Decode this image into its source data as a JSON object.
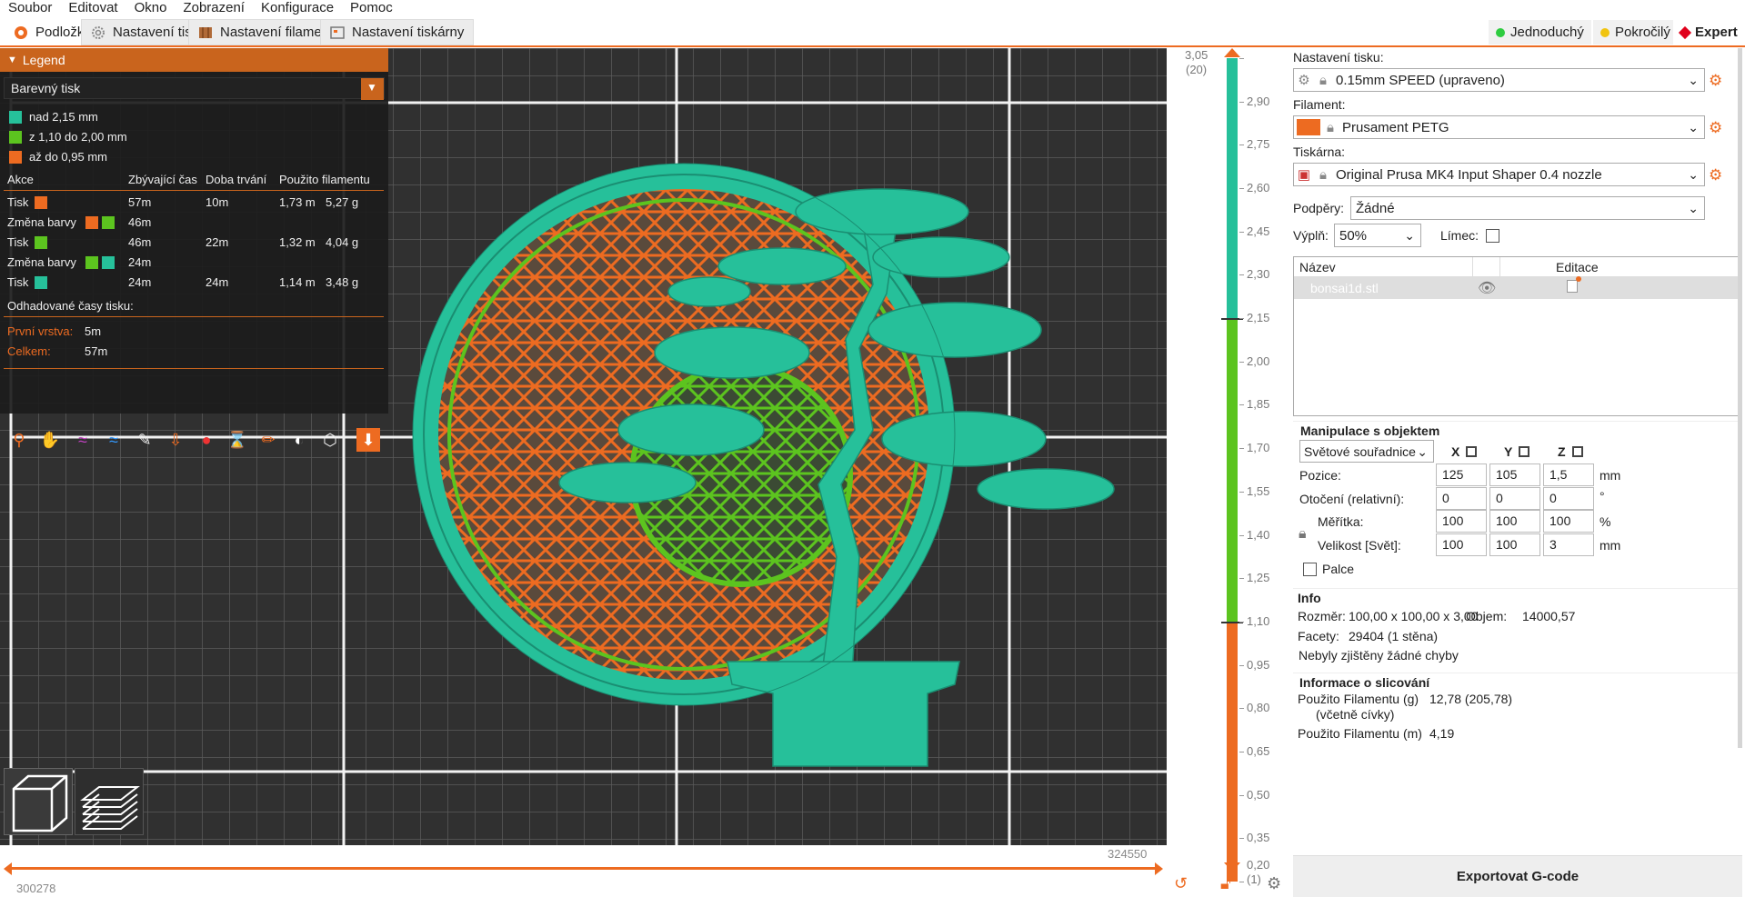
{
  "menu": [
    "Soubor",
    "Editovat",
    "Okno",
    "Zobrazení",
    "Konfigurace",
    "Pomoc"
  ],
  "tabs": [
    {
      "label": "Podložka",
      "icon": "plate-icon"
    },
    {
      "label": "Nastavení tisku",
      "icon": "gear-icon"
    },
    {
      "label": "Nastavení filamentu",
      "icon": "filament-spool-icon"
    },
    {
      "label": "Nastavení tiskárny",
      "icon": "printer-icon"
    }
  ],
  "modes": [
    {
      "label": "Jednoduchý",
      "color": "#2ecc40"
    },
    {
      "label": "Pokročilý",
      "color": "#f1c40f"
    },
    {
      "label": "Expert",
      "color": "#e0001b"
    }
  ],
  "legend": {
    "title": "Legend",
    "view_type": "Barevný tisk",
    "ranges": [
      {
        "label": "nad 2,15 mm",
        "color": "#26c09a"
      },
      {
        "label": "z 1,10 do 2,00 mm",
        "color": "#5cc41f"
      },
      {
        "label": "až do 0,95 mm",
        "color": "#ed6b21"
      }
    ],
    "columns": [
      "Akce",
      "Zbývající čas",
      "Doba trvání",
      "Použito filamentu"
    ],
    "rows": [
      {
        "action": "Tisk",
        "remaining": "57m",
        "duration": "10m",
        "meters": "1,73 m",
        "grams": "5,27 g"
      },
      {
        "action": "Změna barvy",
        "remaining": "46m",
        "duration": "",
        "meters": "",
        "grams": ""
      },
      {
        "action": "Tisk",
        "remaining": "46m",
        "duration": "22m",
        "meters": "1,32 m",
        "grams": "4,04 g"
      },
      {
        "action": "Změna barvy",
        "remaining": "24m",
        "duration": "",
        "meters": "",
        "grams": ""
      },
      {
        "action": "Tisk",
        "remaining": "24m",
        "duration": "24m",
        "meters": "1,14 m",
        "grams": "3,48 g"
      }
    ],
    "estimated_title": "Odhadované časy tisku:",
    "first_layer_label": "První vrstva:",
    "first_layer_value": "5m",
    "total_label": "Celkem:",
    "total_value": "57m"
  },
  "vertical_slider": {
    "top_value": "3,05",
    "top_layer": "(20)",
    "bottom_value": "0,20",
    "bottom_layer": "(1)",
    "ticks": [
      "3,05",
      "2,90",
      "2,75",
      "2,60",
      "2,45",
      "2,30",
      "2,15",
      "2,00",
      "1,85",
      "1,70",
      "1,55",
      "1,40",
      "1,25",
      "1,10",
      "0,95",
      "0,80",
      "0,65",
      "0,50",
      "0,35",
      "0,20"
    ],
    "color_changes": [
      1.1,
      2.15
    ]
  },
  "horizontal_slider": {
    "left_value": "300278",
    "right_value": "324550"
  },
  "right_panel": {
    "print_settings_label": "Nastavení tisku:",
    "print_settings_value": "0.15mm SPEED (upraveno)",
    "filament_label": "Filament:",
    "filament_value": "Prusament PETG",
    "filament_color": "#ed6b21",
    "printer_label": "Tiskárna:",
    "printer_value": "Original Prusa MK4 Input Shaper 0.4 nozzle",
    "supports_label": "Podpěry:",
    "supports_value": "Žádné",
    "infill_label": "Výplň:",
    "infill_value": "50%",
    "brim_label": "Límec:",
    "objects_col_name": "Název",
    "objects_col_edit": "Editace",
    "object_name": "bonsai1d.stl",
    "manip_title": "Manipulace s objektem",
    "coord_system": "Světové souřadnice",
    "axes": [
      "X",
      "Y",
      "Z"
    ],
    "position_label": "Pozice:",
    "position": [
      "125",
      "105",
      "1,5"
    ],
    "position_unit": "mm",
    "rotation_label": "Otočení (relativní):",
    "rotation": [
      "0",
      "0",
      "0"
    ],
    "rotation_unit": "°",
    "scale_label": "Měřítka:",
    "scale": [
      "100",
      "100",
      "100"
    ],
    "scale_unit": "%",
    "size_label": "Velikost [Svět]:",
    "size": [
      "100",
      "100",
      "3"
    ],
    "size_unit": "mm",
    "inches_label": "Palce",
    "info_title": "Info",
    "size_info_label": "Rozměr:",
    "size_info_value": "100,00 x 100,00 x 3,00",
    "volume_label": "Objem:",
    "volume_value": "14000,57",
    "facets_label": "Facety:",
    "facets_value": "29404 (1 stěna)",
    "errors_text": "Nebyly zjištěny žádné chyby",
    "slicing_title": "Informace o slicování",
    "used_g_label": "Použito Filamentu (g)",
    "used_g_sub": "(včetně cívky)",
    "used_g_value": "12,78 (205,78)",
    "used_m_label": "Použito Filamentu (m)",
    "used_m_value": "4,19",
    "export_label": "Exportovat G-code"
  }
}
